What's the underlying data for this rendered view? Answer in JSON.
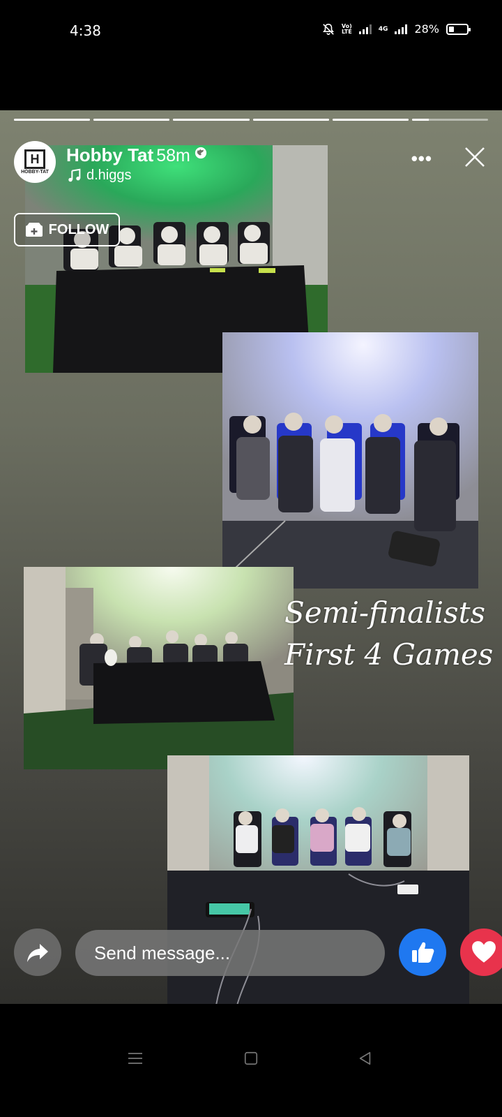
{
  "status_bar": {
    "time": "4:38",
    "volte": "Vo) LTE",
    "network": "4G",
    "battery_percent": "28%",
    "battery_level": 0.28,
    "icons": [
      "bell-off-icon",
      "volte-icon",
      "signal-icon",
      "signal-4g-icon",
      "battery-icon"
    ]
  },
  "story": {
    "progress": {
      "segments": 6,
      "current_segment": 6,
      "current_fill": 0.22
    },
    "page_name": "Hobby Tat",
    "avatar_text": "HOBBY-TAT",
    "post_time": "58m",
    "audience_icon": "globe-icon",
    "music_track": "d.higgs",
    "follow_label": "FOLLOW",
    "caption_line1": "Semi-finalists",
    "caption_line2": "First 4 Games"
  },
  "reply": {
    "placeholder": "Send message..."
  },
  "colors": {
    "like": "#1f78f0",
    "love": "#e8334c",
    "green_light": "#33d36e",
    "blue_light": "#4a5bff"
  }
}
